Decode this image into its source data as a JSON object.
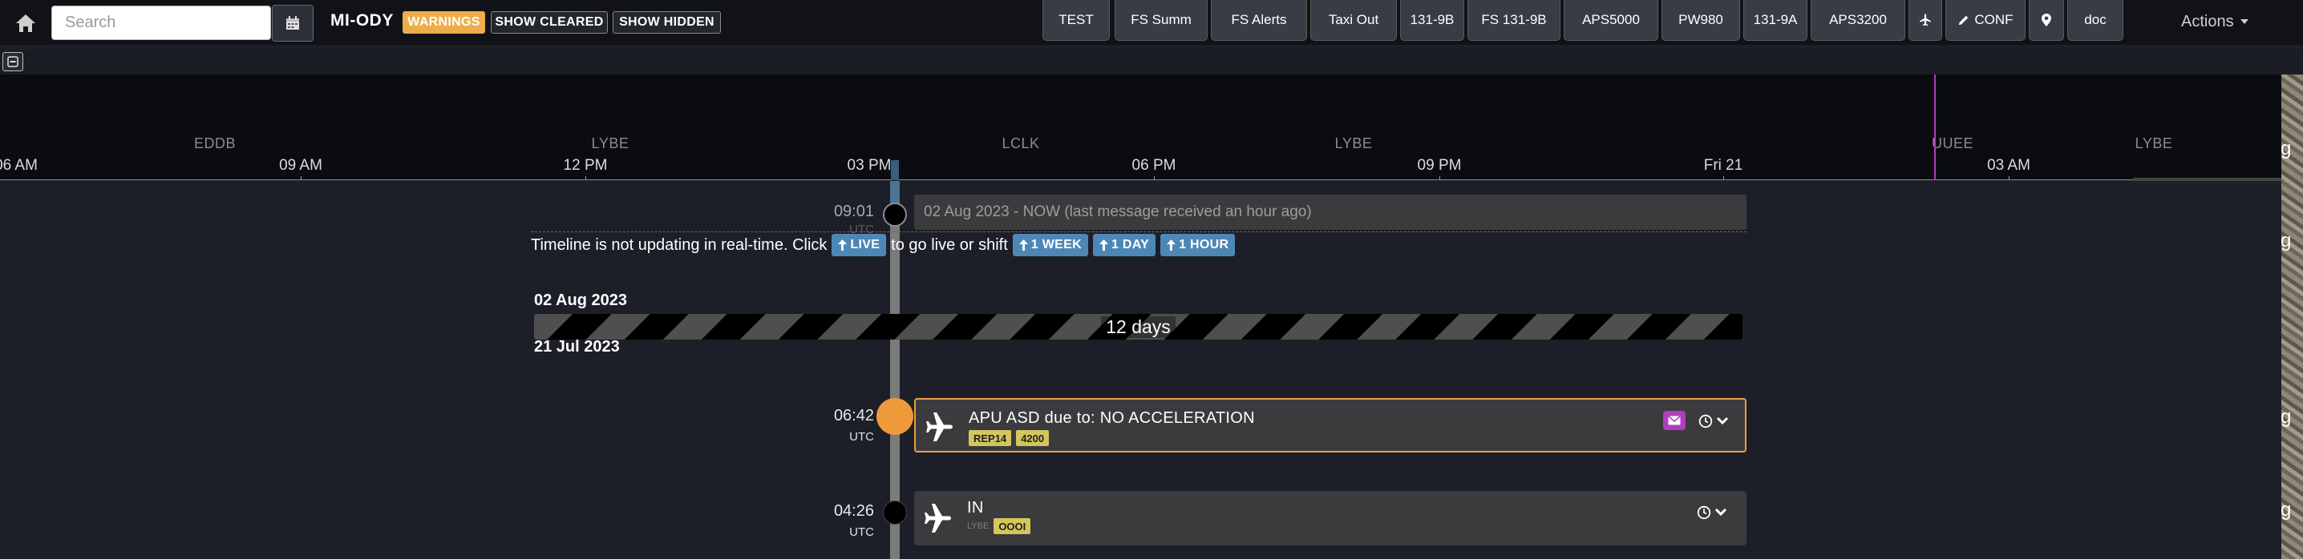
{
  "toolbar": {
    "search_placeholder": "Search",
    "tail_number": "MI-ODY",
    "warnings_label": "WARNINGS",
    "show_cleared_label": "SHOW CLEARED",
    "show_hidden_label": "SHOW HIDDEN",
    "quick_buttons": [
      "TEST",
      "FS Summ",
      "FS Alerts",
      "Taxi Out",
      "131-9B",
      "FS 131-9B",
      "APS5000",
      "PW980",
      "131-9A",
      "APS3200"
    ],
    "conf_label": "CONF",
    "doc_label": "doc",
    "actions_label": "Actions",
    "icons": [
      "home-icon",
      "calendar-icon",
      "plane-icon",
      "pencil-icon",
      "map-pin-icon",
      "caret-down-icon"
    ]
  },
  "overview": {
    "locations": [
      "EDDB",
      "LYBE",
      "LCLK",
      "LYBE",
      "UUEE",
      "LYBE"
    ],
    "times": [
      "06 AM",
      "09 AM",
      "12 PM",
      "03 PM",
      "06 PM",
      "09 PM",
      "Fri 21",
      "03 AM"
    ]
  },
  "edge_glyphs": [
    "g",
    "g",
    "g",
    "g"
  ],
  "timeline": {
    "now": {
      "time": "09:01",
      "zone": "UTC",
      "text": "02 Aug 2023 - NOW (last message received an hour ago)"
    },
    "notice": {
      "text_before": "Timeline is not updating in real-time. Click",
      "live_label": "LIVE",
      "text_middle": "to go live or shift",
      "week_label": "1 WEEK",
      "day_label": "1 DAY",
      "hour_label": "1 HOUR"
    },
    "gap": {
      "end_date": "02 Aug 2023",
      "start_date": "21 Jul 2023",
      "duration": "12 days"
    },
    "events": [
      {
        "time": "06:42",
        "zone": "UTC",
        "title": "APU ASD due to: NO ACCELERATION",
        "tags": [
          "REP14",
          "4200"
        ],
        "severity_color": "#ef9a3a"
      },
      {
        "time": "04:26",
        "zone": "UTC",
        "title": "IN",
        "location": "LYBE",
        "tags": [
          "OOOI"
        ],
        "severity_color": "#000000"
      }
    ]
  },
  "colors": {
    "warning": "#ecae4a",
    "live_button": "#4d87b6",
    "tag": "#d1c75b",
    "mail": "#b03dbd",
    "marker": "#b23bb8"
  }
}
